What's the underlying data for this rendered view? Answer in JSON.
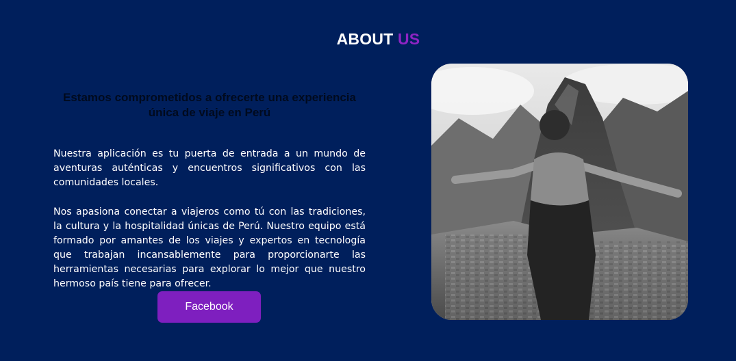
{
  "header": {
    "title_part1": "ABOUT",
    "title_part2": "US",
    "accent_color": "#8e24c4"
  },
  "about": {
    "subtitle": "Estamos comprometidos a ofrecerte una experiencia única de viaje en Perú",
    "paragraph1": "Nuestra aplicación es tu puerta de entrada a un mundo de aventuras auténticas y encuentros significativos con las comunidades locales.",
    "paragraph2": "Nos apasiona conectar a viajeros como tú con las tradiciones, la cultura y la hospitalidad únicas de Perú. Nuestro equipo está formado por amantes de los viajes y expertos en tecnología que trabajan incansablemente para proporcionarte las herramientas necesarias para explorar lo mejor que nuestro hermoso país tiene para ofrecer.",
    "button_label": "Facebook"
  },
  "colors": {
    "background": "#001f5c",
    "button": "#7e1fbf",
    "subtitle_text": "#000a1e"
  }
}
